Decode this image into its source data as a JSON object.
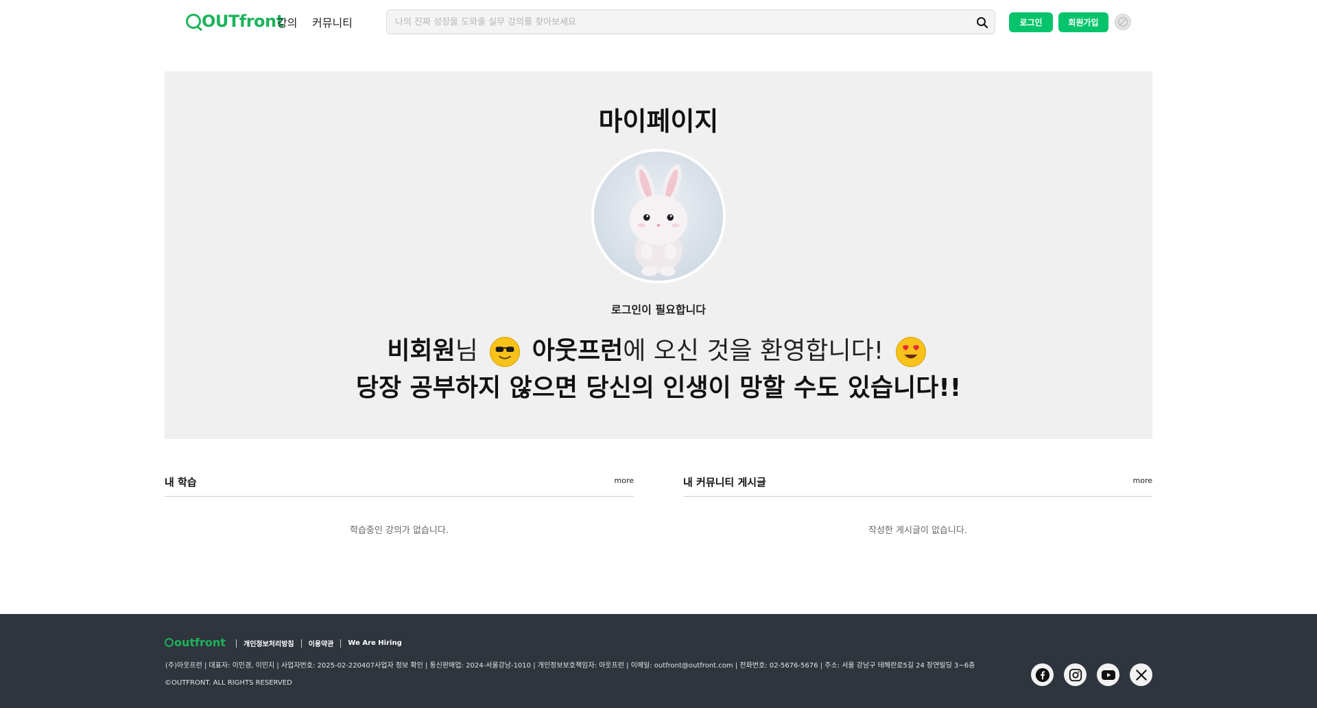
{
  "header": {
    "logo_text": "OUTfront",
    "nav": [
      {
        "label": "강의"
      },
      {
        "label": "커뮤니티"
      }
    ],
    "search": {
      "placeholder": "나의 진짜 성장을 도와줄 실무 강의를 찾아보세요",
      "value": ""
    },
    "login_label": "로그인",
    "signup_label": "회원가입"
  },
  "hero": {
    "title": "마이페이지",
    "login_required": "로그인이 필요합니다",
    "welcome": {
      "user": "비회원",
      "honorific": "님",
      "brand": "아웃프런",
      "tail": "에 오신 것을 환영합니다!"
    },
    "warning": "당장 공부하지 않으면 당신의 인생이 망할 수도 있습니다!!"
  },
  "sections": {
    "learning": {
      "title": "내 학습",
      "more": "more",
      "empty": "학습중인 강의가 없습니다."
    },
    "community": {
      "title": "내 커뮤니티 게시글",
      "more": "more",
      "empty": "작성한 게시글이 없습니다."
    }
  },
  "footer": {
    "logo_text": "outfront",
    "links": [
      "개인정보처리방침",
      "이용약관",
      "We Are Hiring"
    ],
    "info": "(주)아웃프런 | 대표자: 이민경, 이민지 | 사업자번호: 2025-02-220407사업자 정보 확인 | 통신판매업: 2024-서울강남-1010 | 개인정보보호책임자: 아웃프런 | 이메일: outfront@outfront.com | 전화번호: 02-5676-5676 | 주소: 서울 강남구 테헤란로5길 24 장연빌딩 3~6층",
    "copyright": "©OUTFRONT. ALL RIGHTS RESERVED",
    "social_icons": [
      "facebook-icon",
      "instagram-icon",
      "youtube-icon",
      "x-icon"
    ]
  },
  "colors": {
    "brand_green": "#06c46b",
    "logo_green": "#1db35c",
    "footer_bg": "#2f353d",
    "hero_bg": "#f0f0f0"
  }
}
